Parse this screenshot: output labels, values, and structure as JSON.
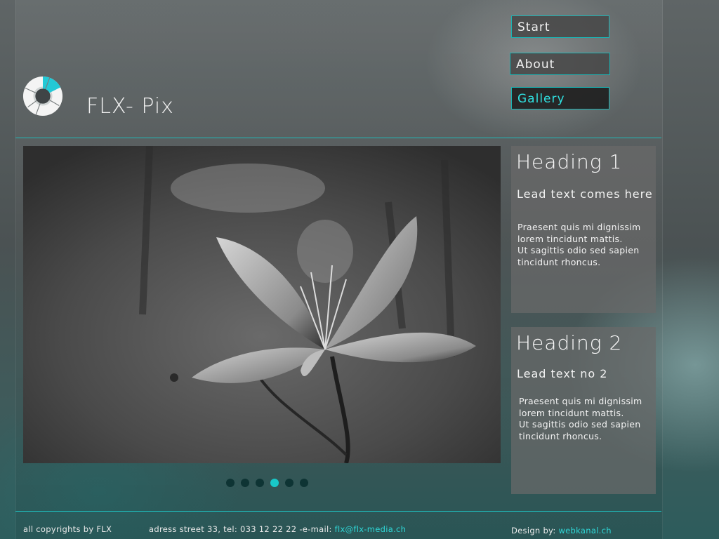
{
  "site": {
    "title": "FLX- Pix"
  },
  "nav": {
    "items": [
      {
        "label": "Start"
      },
      {
        "label": "About"
      },
      {
        "label": "Gallery"
      }
    ],
    "active": "Gallery"
  },
  "sidebar": {
    "boxes": [
      {
        "heading": "Heading 1",
        "lead": "Lead text comes here",
        "body_lines": [
          "Praesent quis mi dignissim",
          "lorem tincidunt mattis.",
          "Ut sagittis odio sed sapien",
          "tincidunt rhoncus."
        ]
      },
      {
        "heading": "Heading 2",
        "lead": "Lead text no 2",
        "body_lines": [
          "Praesent quis mi dignissim",
          "lorem tincidunt mattis.",
          "Ut sagittis odio sed sapien",
          "tincidunt rhoncus."
        ]
      }
    ]
  },
  "slider": {
    "dot_count": 6,
    "active_index": 3
  },
  "footer": {
    "copyright": "all copyrights by FLX",
    "address_prefix": "adress street 33, tel: 033 12 22 22 -e-mail: ",
    "email": "flx@flx-media.ch",
    "design_prefix": "Design by: ",
    "design_link": "webkanal.ch"
  },
  "colors": {
    "accent": "#1fbcbc",
    "active_text": "#2fe0e0"
  }
}
